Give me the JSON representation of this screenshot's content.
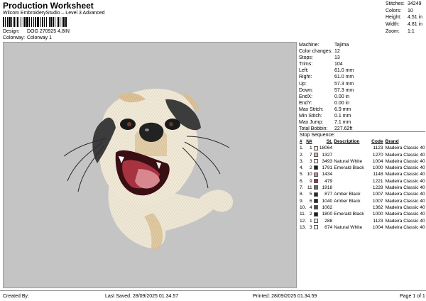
{
  "header": {
    "title": "Production Worksheet",
    "subtitle": "Wilcom EmbroideryStudio – Level 3 Advanced",
    "design_label": "Design:",
    "design_value": "DOG 270925 4,8IN",
    "colorway_label": "Colorway:",
    "colorway_value": "Colorway 1"
  },
  "stats": [
    {
      "k": "Stitches:",
      "v": "34249"
    },
    {
      "k": "Colors:",
      "v": "10"
    },
    {
      "k": "Height:",
      "v": "4.51 in"
    },
    {
      "k": "Width:",
      "v": "4.81 in"
    },
    {
      "k": "Zoom:",
      "v": "1:1"
    }
  ],
  "machine_info": [
    {
      "k": "Machine:",
      "v": "Tajima"
    },
    {
      "k": "Color changes:",
      "v": "12"
    },
    {
      "k": "Stops:",
      "v": "13"
    },
    {
      "k": "Trims:",
      "v": "104"
    },
    {
      "k": "Left:",
      "v": "61.0 mm"
    },
    {
      "k": "Right:",
      "v": "61.0 mm"
    },
    {
      "k": "Up:",
      "v": "57.3 mm"
    },
    {
      "k": "Down:",
      "v": "57.3 mm"
    },
    {
      "k": "EndX:",
      "v": "0.00 in"
    },
    {
      "k": "EndY:",
      "v": "0.00 in"
    },
    {
      "k": "Max Stitch:",
      "v": "6.9 mm"
    },
    {
      "k": "Min Stitch:",
      "v": "0.1 mm"
    },
    {
      "k": "Max Jump:",
      "v": "7.1 mm"
    },
    {
      "k": "Total Bobbin:",
      "v": "227.62ft"
    }
  ],
  "stop_sequence": {
    "title": "Stop Sequence:",
    "headers": {
      "num": "#",
      "n": "N#",
      "st": "St.",
      "desc": "Description",
      "code": "Code",
      "brand": "Brand"
    },
    "rows": [
      {
        "num": "1.",
        "n": "1",
        "color": "#f3eee3",
        "st": "18064",
        "desc": "",
        "code": "1123",
        "brand": "Madeira Classic 40"
      },
      {
        "num": "2.",
        "n": "7",
        "color": "#e2b98c",
        "st": "1327",
        "desc": "",
        "code": "1270",
        "brand": "Madeira Classic 40"
      },
      {
        "num": "3.",
        "n": "3",
        "color": "#fbfbf6",
        "st": "3493",
        "desc": "Natural White",
        "code": "1004",
        "brand": "Madeira Classic 40"
      },
      {
        "num": "4.",
        "n": "2",
        "color": "#1a1a1a",
        "st": "1791",
        "desc": "Emerald Black",
        "code": "1000",
        "brand": "Madeira Classic 40"
      },
      {
        "num": "5.",
        "n": "10",
        "color": "#d9878f",
        "st": "1434",
        "desc": "",
        "code": "1148",
        "brand": "Madeira Classic 40"
      },
      {
        "num": "6.",
        "n": "9",
        "color": "#a83340",
        "st": "479",
        "desc": "",
        "code": "1221",
        "brand": "Madeira Classic 40"
      },
      {
        "num": "7.",
        "n": "11",
        "color": "#6a6a6a",
        "st": "1918",
        "desc": "",
        "code": "1228",
        "brand": "Madeira Classic 40"
      },
      {
        "num": "8.",
        "n": "5",
        "color": "#2a2a2a",
        "st": "877",
        "desc": "Amber Black",
        "code": "1007",
        "brand": "Madeira Classic 40"
      },
      {
        "num": "9.",
        "n": "6",
        "color": "#2a2a2a",
        "st": "1040",
        "desc": "Amber Black",
        "code": "1007",
        "brand": "Madeira Classic 40"
      },
      {
        "num": "10.",
        "n": "4",
        "color": "#4a4a4a",
        "st": "1062",
        "desc": "",
        "code": "1362",
        "brand": "Madeira Classic 40"
      },
      {
        "num": "11.",
        "n": "2",
        "color": "#1a1a1a",
        "st": "1800",
        "desc": "Emerald Black",
        "code": "1000",
        "brand": "Madeira Classic 40"
      },
      {
        "num": "12.",
        "n": "1",
        "color": "#f3eee3",
        "st": "288",
        "desc": "",
        "code": "1123",
        "brand": "Madeira Classic 40"
      },
      {
        "num": "13.",
        "n": "3",
        "color": "#fbfbf6",
        "st": "674",
        "desc": "Natural White",
        "code": "1004",
        "brand": "Madeira Classic 40"
      }
    ]
  },
  "footer": {
    "created_by": "Created By:",
    "last_saved": "Last Saved: 28/09/2025 01.34.57",
    "printed": "Printed: 28/09/2025 01.34.59",
    "page": "Page 1 of 1"
  },
  "colors": {
    "canvas_bg": "#c4c4c4",
    "fur_light": "#f1ead8",
    "fur_tan": "#dcc296",
    "fur_dark": "#3c3c3c",
    "mouth": "#a83340",
    "tongue": "#d9878f"
  }
}
